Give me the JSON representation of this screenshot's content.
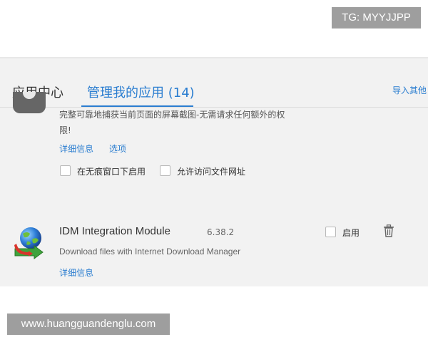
{
  "watermarks": {
    "top": "TG: MYYJJPP",
    "bottom": "www.huangguandenglu.com"
  },
  "tabs": {
    "apps": "应用中心",
    "manage": "管理我的应用 (14)"
  },
  "import_link": "导入其他",
  "extensions": [
    {
      "description_line1": "完整可靠地捕获当前页面的屏幕截图-无需请求任何额外的权",
      "description_line2": "限!",
      "details_link": "详细信息",
      "options_link": "选项",
      "incognito_label": "在无痕窗口下启用",
      "file_url_label": "允许访问文件网址"
    },
    {
      "name": "IDM Integration Module",
      "version": "6.38.2",
      "enable_label": "启用",
      "description": "Download files with Internet Download Manager",
      "details_link": "详细信息"
    }
  ],
  "colors": {
    "accent": "#2a7dd0",
    "panel_bg": "#f2f2f2",
    "watermark_bg": "#9e9e9e"
  }
}
